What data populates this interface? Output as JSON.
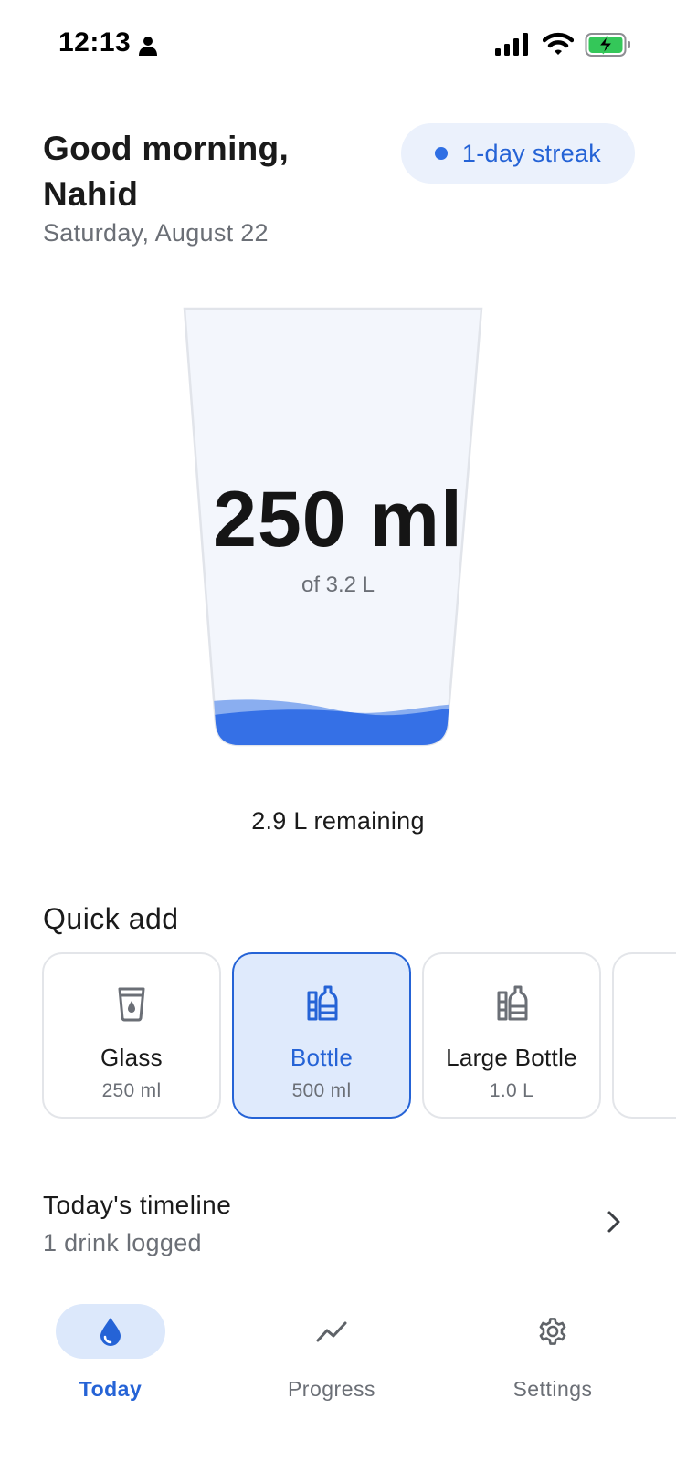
{
  "status_bar": {
    "time": "12:13",
    "icons": [
      "person-icon",
      "signal-icon",
      "wifi-icon",
      "battery-charging-icon"
    ],
    "battery_color": "#34c759"
  },
  "header": {
    "greeting": "Good morning, Nahid",
    "date": "Saturday, August 22",
    "streak": "1-day streak"
  },
  "intake": {
    "amount": "250 ml",
    "goal": "of 3.2 L",
    "remaining": "2.9 L remaining",
    "fill_fraction": 0.078
  },
  "quick_add": {
    "title": "Quick add",
    "items": [
      {
        "label": "Glass",
        "amount": "250 ml",
        "icon": "glass-icon",
        "selected": false
      },
      {
        "label": "Bottle",
        "amount": "500 ml",
        "icon": "bottle-icon",
        "selected": true
      },
      {
        "label": "Large Bottle",
        "amount": "1.0 L",
        "icon": "bottle-icon",
        "selected": false
      }
    ]
  },
  "timeline": {
    "title": "Today's timeline",
    "subtitle": "1 drink logged"
  },
  "nav": {
    "items": [
      {
        "label": "Today",
        "icon": "water-drop-icon",
        "active": true
      },
      {
        "label": "Progress",
        "icon": "trend-icon",
        "active": false
      },
      {
        "label": "Settings",
        "icon": "gear-icon",
        "active": false
      }
    ]
  },
  "colors": {
    "accent": "#2563d6",
    "water": "#3570e6",
    "water_light": "#8aaef0",
    "glass_fill": "#f3f6fc",
    "selected_card_bg": "#dfeafc",
    "streak_bg": "#ebf1fc"
  }
}
